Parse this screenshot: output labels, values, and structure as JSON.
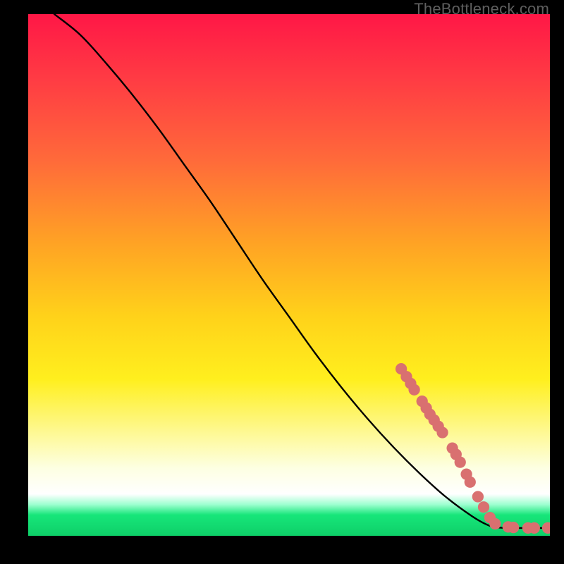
{
  "attribution": "TheBottleneck.com",
  "colors": {
    "curve": "#000000",
    "dot": "#d97070",
    "gradient_top": "#ff1746",
    "gradient_bottom": "#0ecf68"
  },
  "chart_data": {
    "type": "line",
    "title": "",
    "xlabel": "",
    "ylabel": "",
    "xlim": [
      0,
      100
    ],
    "ylim": [
      0,
      100
    ],
    "curve_comment": "x,y pairs in percent of plot area (0–100); y is visual height (100=top). Curve starts top-left, sweeps concave/straight diagonal to a floor near bottom-right.",
    "curve": [
      [
        5,
        100
      ],
      [
        10,
        96
      ],
      [
        15,
        90.5
      ],
      [
        20,
        84.5
      ],
      [
        25,
        78
      ],
      [
        30,
        71
      ],
      [
        35,
        64
      ],
      [
        40,
        56.5
      ],
      [
        45,
        49
      ],
      [
        50,
        42
      ],
      [
        55,
        35
      ],
      [
        60,
        28.5
      ],
      [
        65,
        22.5
      ],
      [
        70,
        17
      ],
      [
        75,
        12
      ],
      [
        80,
        7.5
      ],
      [
        85,
        3.8
      ],
      [
        88,
        2.1
      ],
      [
        90,
        1.6
      ],
      [
        93,
        1.5
      ],
      [
        96,
        1.5
      ],
      [
        100,
        1.5
      ]
    ],
    "dots_comment": "clustered salmon dots riding the lower-right segment of the curve and the flat tail",
    "dots": [
      [
        71.5,
        32.0
      ],
      [
        72.5,
        30.5
      ],
      [
        73.3,
        29.2
      ],
      [
        74.0,
        28.0
      ],
      [
        75.5,
        25.8
      ],
      [
        76.3,
        24.5
      ],
      [
        77.0,
        23.3
      ],
      [
        77.8,
        22.2
      ],
      [
        78.6,
        21.0
      ],
      [
        79.4,
        19.8
      ],
      [
        81.3,
        16.8
      ],
      [
        82.0,
        15.6
      ],
      [
        82.8,
        14.1
      ],
      [
        84.0,
        11.8
      ],
      [
        84.7,
        10.3
      ],
      [
        86.2,
        7.5
      ],
      [
        87.3,
        5.5
      ],
      [
        88.5,
        3.5
      ],
      [
        89.5,
        2.3
      ],
      [
        92.0,
        1.7
      ],
      [
        93.0,
        1.6
      ],
      [
        95.8,
        1.5
      ],
      [
        97.0,
        1.5
      ],
      [
        99.6,
        1.5
      ]
    ],
    "dot_radius_pct": 1.1
  }
}
